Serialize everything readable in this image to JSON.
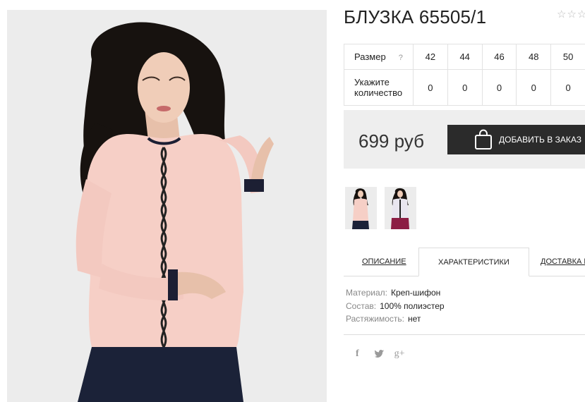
{
  "product": {
    "title": "БЛУЗКА 65505/1",
    "rating": {
      "filled": 0,
      "max": 3
    },
    "price": "699 руб",
    "add_to_order_label": "ДОБАВИТЬ В ЗАКАЗ"
  },
  "size_table": {
    "size_label": "Размер",
    "help_glyph": "?",
    "quantity_label": "Укажите количество",
    "sizes": [
      "42",
      "44",
      "46",
      "48",
      "50"
    ],
    "quantities": [
      "0",
      "0",
      "0",
      "0",
      "0"
    ]
  },
  "tabs": [
    {
      "label": "ОПИСАНИЕ",
      "active": false
    },
    {
      "label": "ХАРАКТЕРИСТИКИ",
      "active": true
    },
    {
      "label": "ДОСТАВКА И",
      "active": false
    }
  ],
  "specs": [
    {
      "key": "Материал:",
      "value": "Креп-шифон"
    },
    {
      "key": "Состав:",
      "value": "100% полиэстер"
    },
    {
      "key": "Растяжимость:",
      "value": "нет"
    }
  ],
  "social": [
    {
      "icon": "facebook-icon",
      "glyph": "f"
    },
    {
      "icon": "twitter-icon",
      "glyph": "t"
    },
    {
      "icon": "google-plus-icon",
      "glyph": "g+"
    }
  ],
  "colors": {
    "button_bg": "#2b2b2b",
    "price_box_bg": "#eeeeee",
    "border": "#e2e2e2",
    "blouse": "#f6cfc6",
    "blouse_alt": "#e9e6ef",
    "hair": "#17120f"
  }
}
